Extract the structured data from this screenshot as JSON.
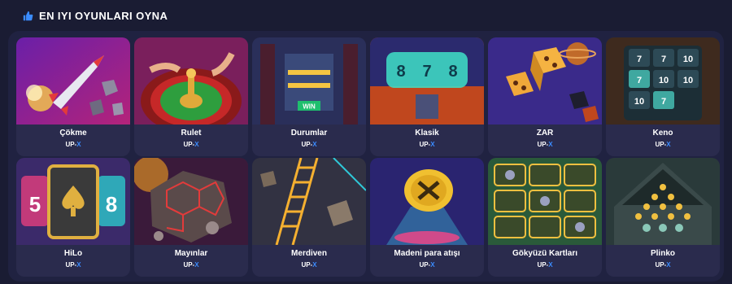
{
  "header": {
    "title": "EN IYI OYUNLARI OYNA",
    "icon": "thumbs-up-icon",
    "icon_color": "#3b8cff"
  },
  "brand": {
    "prefix": "UP-",
    "suffix": "X",
    "accent": "#3b8cff"
  },
  "games": [
    {
      "name": "Çökme",
      "slug": "cokme"
    },
    {
      "name": "Rulet",
      "slug": "rulet"
    },
    {
      "name": "Durumlar",
      "slug": "durumlar"
    },
    {
      "name": "Klasik",
      "slug": "klasik"
    },
    {
      "name": "ZAR",
      "slug": "zar"
    },
    {
      "name": "Keno",
      "slug": "keno"
    },
    {
      "name": "HiLo",
      "slug": "hilo"
    },
    {
      "name": "Mayınlar",
      "slug": "mayinlar"
    },
    {
      "name": "Merdiven",
      "slug": "merdiven"
    },
    {
      "name": "Madeni para atışı",
      "slug": "madeni-para-atisi"
    },
    {
      "name": "Gökyüzü Kartları",
      "slug": "gokyuzu-kartlari"
    },
    {
      "name": "Plinko",
      "slug": "plinko"
    }
  ],
  "art_text": {
    "durumlar_win": "WIN",
    "klasik_reels": [
      "8",
      "7",
      "8"
    ],
    "keno_numbers": [
      "7",
      "7",
      "10",
      "7",
      "10",
      "10",
      "10",
      "7"
    ],
    "hilo_left": "5",
    "hilo_right": "8"
  }
}
